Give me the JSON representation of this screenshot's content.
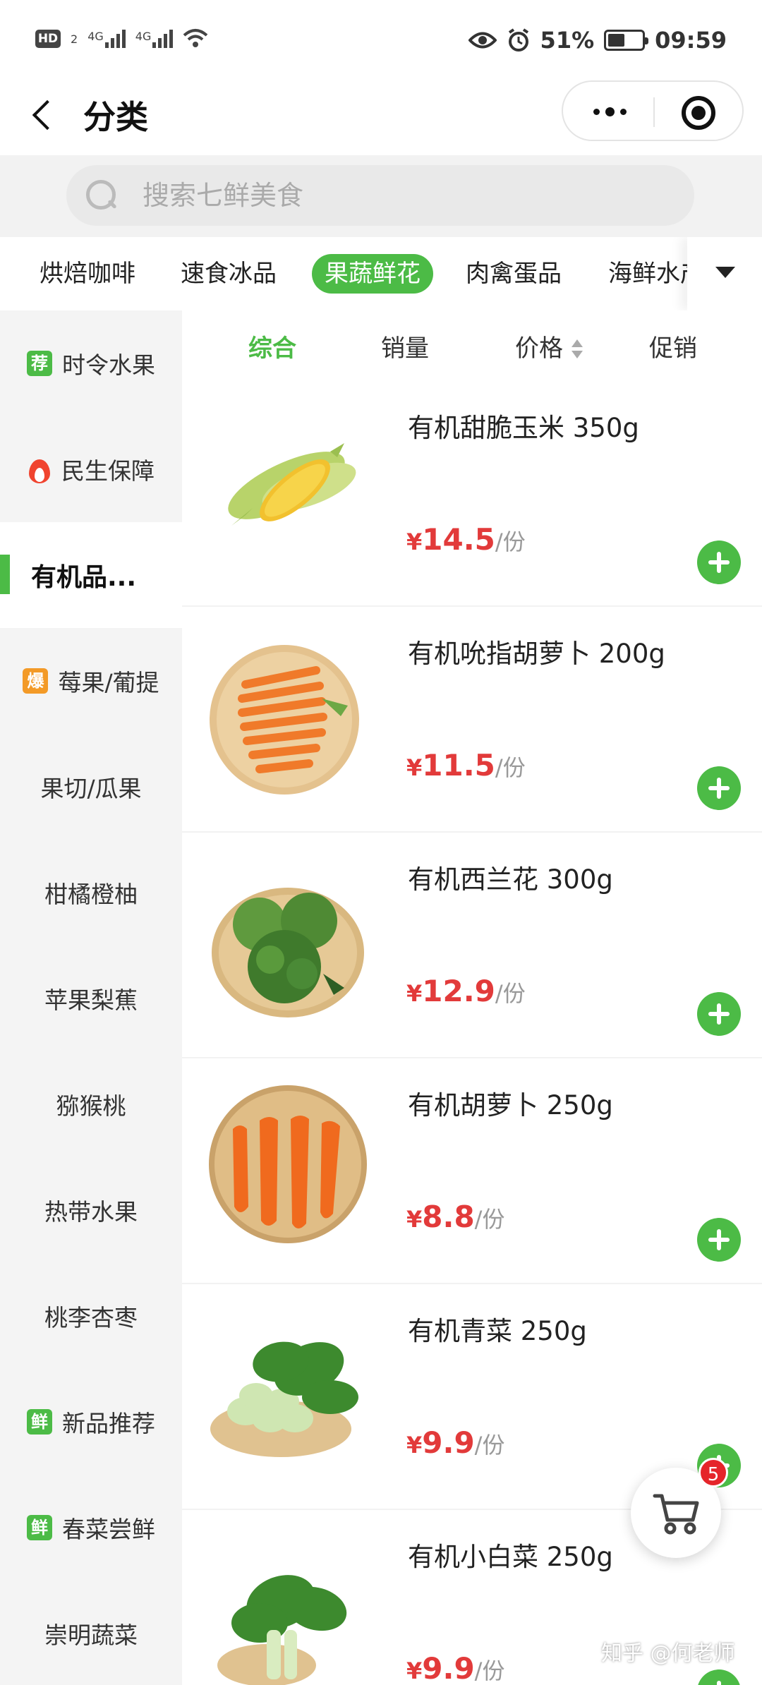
{
  "status_bar": {
    "hd": "HD",
    "sim": "2",
    "net1": "4G",
    "net2": "4G",
    "battery_text": "51%",
    "battery_level": 0.51,
    "time": "09:59"
  },
  "header": {
    "title": "分类"
  },
  "search": {
    "placeholder": "搜索七鲜美食"
  },
  "category_tabs": [
    {
      "label": "烘焙咖啡"
    },
    {
      "label": "速食冰品"
    },
    {
      "label": "果蔬鲜花",
      "active": true
    },
    {
      "label": "肉禽蛋品"
    },
    {
      "label": "海鲜水产"
    }
  ],
  "sidebar": {
    "items": [
      {
        "label": "时令水果",
        "tag": "荐",
        "tag_color": "#4cbb46"
      },
      {
        "label": "民生保障",
        "icon": "fire-icon"
      },
      {
        "label": "有机品...",
        "active": true
      },
      {
        "label": "莓果/葡提",
        "tag": "爆",
        "tag_color": "#f39a27"
      },
      {
        "label": "果切/瓜果"
      },
      {
        "label": "柑橘橙柚"
      },
      {
        "label": "苹果梨蕉"
      },
      {
        "label": "猕猴桃"
      },
      {
        "label": "热带水果"
      },
      {
        "label": "桃李杏枣"
      },
      {
        "label": "新品推荐",
        "tag": "鲜",
        "tag_color": "#4cbb46"
      },
      {
        "label": "春菜尝鲜",
        "tag": "鲜",
        "tag_color": "#4cbb46"
      },
      {
        "label": "崇明蔬菜"
      }
    ]
  },
  "sort": {
    "composite": "综合",
    "sales": "销量",
    "price": "价格",
    "promo": "促销"
  },
  "products": [
    {
      "name": "有机甜脆玉米 350g",
      "yen": "¥",
      "price": "14.5",
      "unit": "/份",
      "image": "corn"
    },
    {
      "name": "有机吮指胡萝卜 200g",
      "yen": "¥",
      "price": "11.5",
      "unit": "/份",
      "image": "baby-carrot"
    },
    {
      "name": "有机西兰花 300g",
      "yen": "¥",
      "price": "12.9",
      "unit": "/份",
      "image": "broccoli"
    },
    {
      "name": "有机胡萝卜 250g",
      "yen": "¥",
      "price": "8.8",
      "unit": "/份",
      "image": "carrot"
    },
    {
      "name": "有机青菜 250g",
      "yen": "¥",
      "price": "9.9",
      "unit": "/份",
      "image": "bok-choy"
    },
    {
      "name": "有机小白菜 250g",
      "yen": "¥",
      "price": "9.9",
      "unit": "/份",
      "image": "cabbage"
    }
  ],
  "cart": {
    "count": "5"
  },
  "watermark": "知乎 @何老师"
}
